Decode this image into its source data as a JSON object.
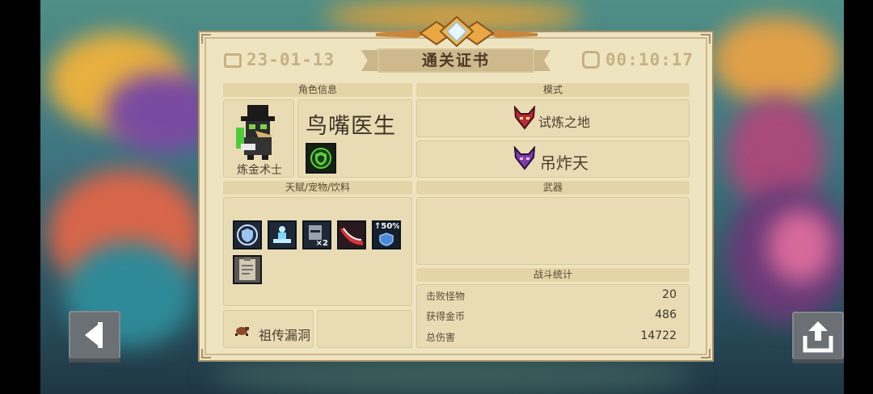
{
  "certificate": {
    "title": "通关证书",
    "date": "23-01-13",
    "time": "00:10:17"
  },
  "sections": {
    "character_info": "角色信息",
    "mode": "模式",
    "talents": "天赋/宠物/饮料",
    "weapon": "武器",
    "battle_stats": "战斗统计"
  },
  "character": {
    "name": "鸟嘴医生",
    "class": "炼金术士",
    "skill_icon": "green-shield-icon"
  },
  "modes": [
    {
      "label": "试炼之地",
      "icon": "demon-mask-red-icon"
    },
    {
      "label": "吊炸天",
      "icon": "demon-mask-purple-icon"
    }
  ],
  "talent_icons": [
    {
      "name": "shield-badge-icon",
      "caption": ""
    },
    {
      "name": "meditating-figure-icon",
      "caption": ""
    },
    {
      "name": "knight-helmet-x2-icon",
      "caption": "×2"
    },
    {
      "name": "red-slash-icon",
      "caption": ""
    },
    {
      "name": "shield-up-icon",
      "caption": "↑50%"
    },
    {
      "name": "clipboard-icon",
      "caption": ""
    }
  ],
  "legacy": {
    "label": "祖传漏洞",
    "icon": "bug-icon"
  },
  "stats": [
    {
      "label": "击败怪物",
      "value": "20"
    },
    {
      "label": "获得金币",
      "value": "486"
    },
    {
      "label": "总伤害",
      "value": "14722"
    }
  ],
  "controls": {
    "back_icon": "back-arrow-icon",
    "share_icon": "share-icon"
  },
  "colors": {
    "panel": "#efe4c0",
    "header_gold": "#c7b183",
    "text_dark": "#3e3528"
  }
}
